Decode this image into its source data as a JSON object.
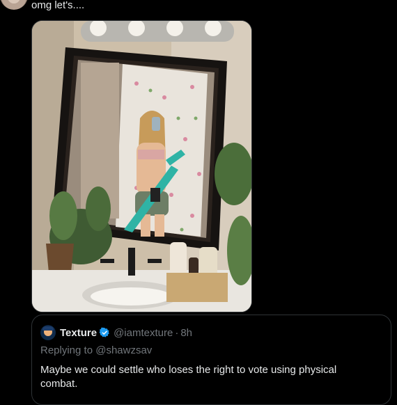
{
  "tweet": {
    "text": "omg let's...."
  },
  "quote": {
    "author_name": "Texture",
    "handle": "@iamtexture",
    "separator": "·",
    "time": "8h",
    "replying_to": "Replying to @shawzsav",
    "text": "Maybe we could settle who loses the right to vote using physical combat."
  },
  "colors": {
    "verified": "#1d9bf0",
    "muted": "#71767b",
    "border": "#2f3336"
  }
}
